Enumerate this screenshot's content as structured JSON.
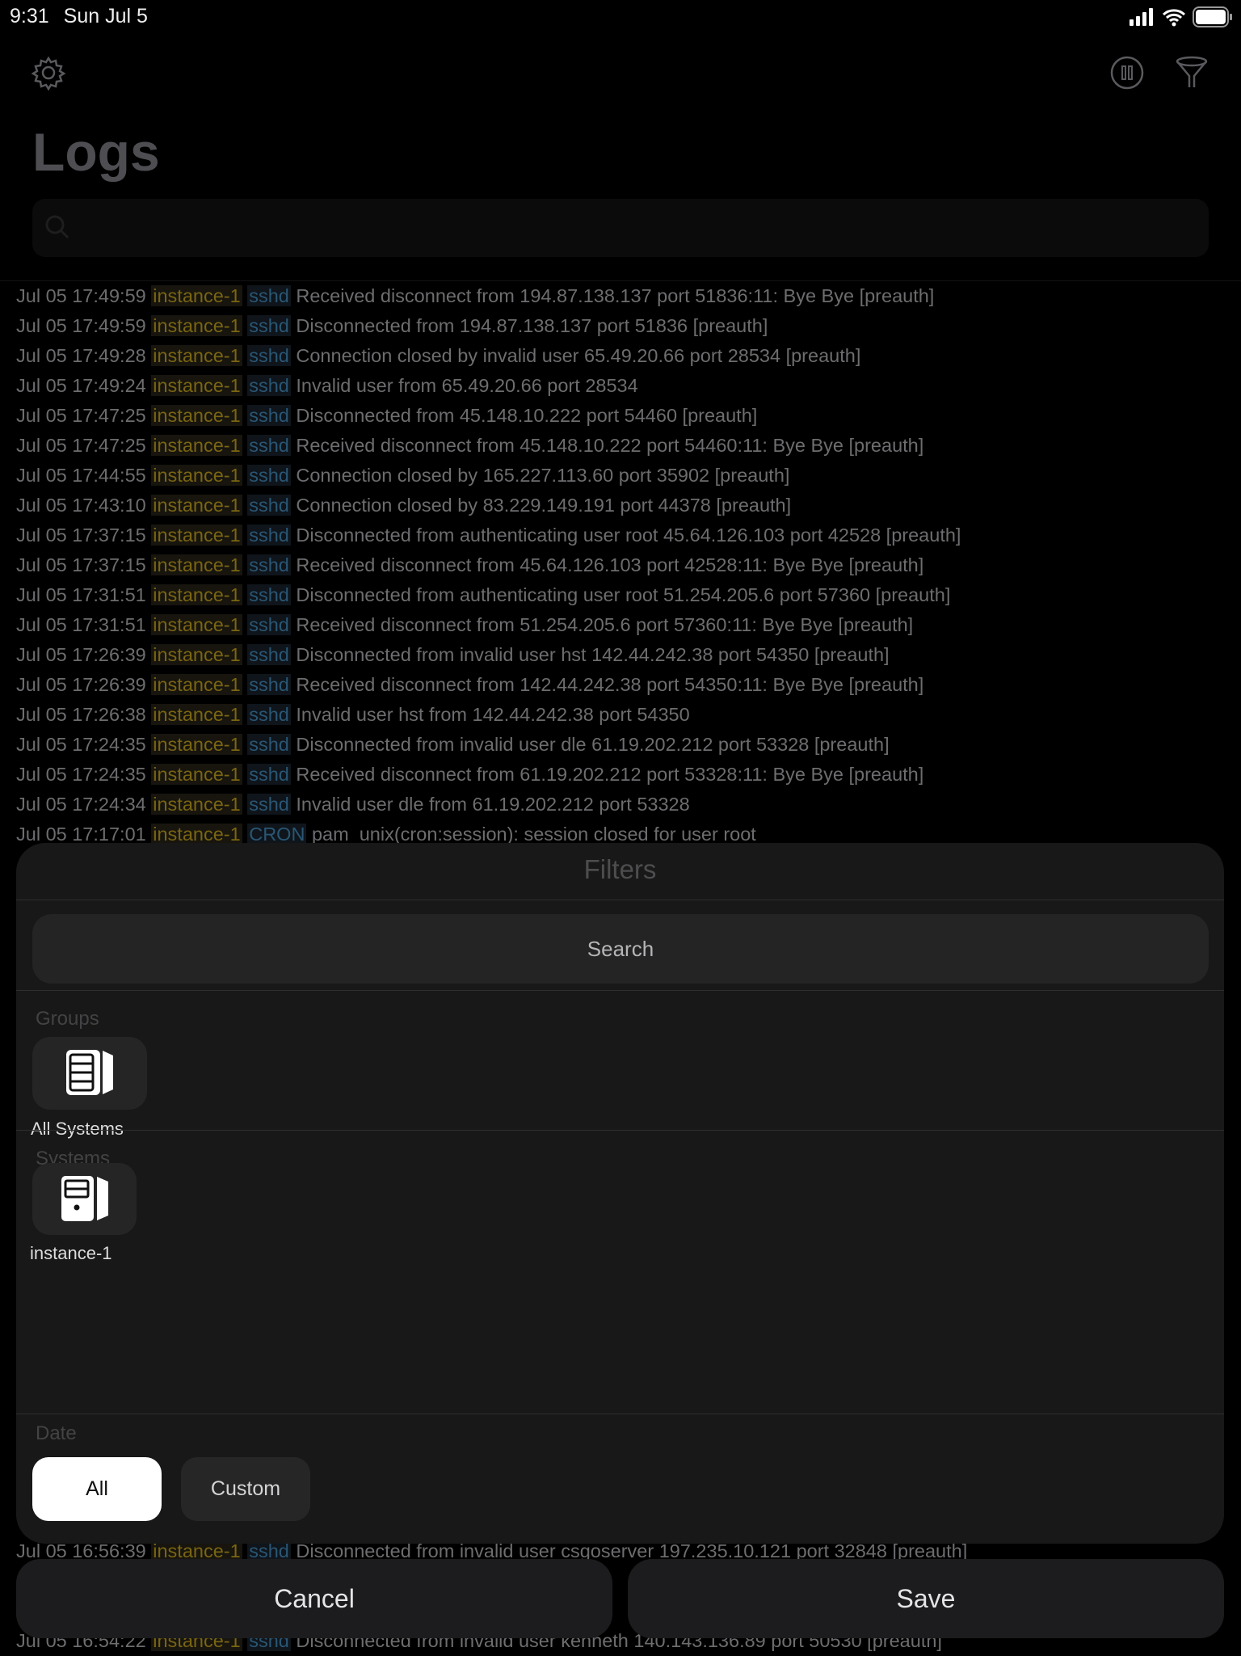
{
  "status_bar": {
    "time": "9:31",
    "date": "Sun Jul 5"
  },
  "header": {
    "title": "Logs",
    "settings_icon": "gear-icon",
    "pause_icon": "pause-circle-icon",
    "filter_icon": "funnel-icon",
    "search_placeholder": ""
  },
  "logs": [
    {
      "time": "Jul 05 17:49:59",
      "host": "instance-1",
      "proc": "sshd",
      "msg": "Received disconnect from 194.87.138.137 port 51836:11: Bye Bye [preauth]"
    },
    {
      "time": "Jul 05 17:49:59",
      "host": "instance-1",
      "proc": "sshd",
      "msg": "Disconnected from 194.87.138.137 port 51836 [preauth]"
    },
    {
      "time": "Jul 05 17:49:28",
      "host": "instance-1",
      "proc": "sshd",
      "msg": "Connection closed by invalid user  65.49.20.66 port 28534 [preauth]"
    },
    {
      "time": "Jul 05 17:49:24",
      "host": "instance-1",
      "proc": "sshd",
      "msg": "Invalid user  from 65.49.20.66 port 28534"
    },
    {
      "time": "Jul 05 17:47:25",
      "host": "instance-1",
      "proc": "sshd",
      "msg": "Disconnected from 45.148.10.222 port 54460 [preauth]"
    },
    {
      "time": "Jul 05 17:47:25",
      "host": "instance-1",
      "proc": "sshd",
      "msg": "Received disconnect from 45.148.10.222 port 54460:11: Bye Bye [preauth]"
    },
    {
      "time": "Jul 05 17:44:55",
      "host": "instance-1",
      "proc": "sshd",
      "msg": "Connection closed by 165.227.113.60 port 35902 [preauth]"
    },
    {
      "time": "Jul 05 17:43:10",
      "host": "instance-1",
      "proc": "sshd",
      "msg": "Connection closed by 83.229.149.191 port 44378 [preauth]"
    },
    {
      "time": "Jul 05 17:37:15",
      "host": "instance-1",
      "proc": "sshd",
      "msg": "Disconnected from authenticating user root 45.64.126.103 port 42528 [preauth]"
    },
    {
      "time": "Jul 05 17:37:15",
      "host": "instance-1",
      "proc": "sshd",
      "msg": "Received disconnect from 45.64.126.103 port 42528:11: Bye Bye [preauth]"
    },
    {
      "time": "Jul 05 17:31:51",
      "host": "instance-1",
      "proc": "sshd",
      "msg": "Disconnected from authenticating user root 51.254.205.6 port 57360 [preauth]"
    },
    {
      "time": "Jul 05 17:31:51",
      "host": "instance-1",
      "proc": "sshd",
      "msg": "Received disconnect from 51.254.205.6 port 57360:11: Bye Bye [preauth]"
    },
    {
      "time": "Jul 05 17:26:39",
      "host": "instance-1",
      "proc": "sshd",
      "msg": "Disconnected from invalid user hst 142.44.242.38 port 54350 [preauth]"
    },
    {
      "time": "Jul 05 17:26:39",
      "host": "instance-1",
      "proc": "sshd",
      "msg": "Received disconnect from 142.44.242.38 port 54350:11: Bye Bye [preauth]"
    },
    {
      "time": "Jul 05 17:26:38",
      "host": "instance-1",
      "proc": "sshd",
      "msg": "Invalid user hst from 142.44.242.38 port 54350"
    },
    {
      "time": "Jul 05 17:24:35",
      "host": "instance-1",
      "proc": "sshd",
      "msg": "Disconnected from invalid user dle 61.19.202.212 port 53328 [preauth]"
    },
    {
      "time": "Jul 05 17:24:35",
      "host": "instance-1",
      "proc": "sshd",
      "msg": "Received disconnect from 61.19.202.212 port 53328:11: Bye Bye [preauth]"
    },
    {
      "time": "Jul 05 17:24:34",
      "host": "instance-1",
      "proc": "sshd",
      "msg": "Invalid user dle from 61.19.202.212 port 53328"
    },
    {
      "time": "Jul 05 17:17:01",
      "host": "instance-1",
      "proc": "CRON",
      "msg": "pam_unix(cron:session): session closed for user root"
    }
  ],
  "logs_bottom": [
    {
      "time": "Jul 05 16:56:39",
      "host": "instance-1",
      "proc": "sshd",
      "msg": "Disconnected from invalid user csgoserver 197.235.10.121 port 32848 [preauth]"
    },
    {
      "time": "Jul 05 16:54:22",
      "host": "instance-1",
      "proc": "sshd",
      "msg": "Disconnected from invalid user kenneth 140.143.136.89 port 50530 [preauth]"
    }
  ],
  "filters": {
    "title": "Filters",
    "search_label": "Search",
    "groups_label": "Groups",
    "groups": [
      {
        "label": "All Systems",
        "icon": "server-rack-icon"
      }
    ],
    "systems_label": "Systems",
    "systems": [
      {
        "label": "instance-1",
        "icon": "server-tower-icon"
      }
    ],
    "date_label": "Date",
    "date_options": [
      {
        "label": "All",
        "selected": true
      },
      {
        "label": "Custom",
        "selected": false
      }
    ]
  },
  "actions": {
    "cancel": "Cancel",
    "save": "Save"
  }
}
